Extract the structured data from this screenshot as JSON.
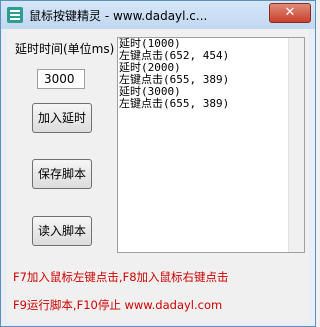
{
  "window": {
    "title": "鼠标按键精灵 - www.dadayl.c..."
  },
  "controls": {
    "delay_label": "延时时间(单位ms)",
    "delay_value": "3000",
    "add_delay": "加入延时",
    "save_script": "保存脚本",
    "load_script": "读入脚本"
  },
  "log": {
    "lines": [
      "延时(1000)",
      "左键点击(652, 454)",
      "延时(2000)",
      "左键点击(655, 389)",
      "延时(3000)",
      "左键点击(655, 389)"
    ]
  },
  "hints": {
    "line1": "F7加入鼠标左键点击,F8加入鼠标右键点击",
    "line2": "F9运行脚本,F10停止  www.dadayl.com"
  }
}
